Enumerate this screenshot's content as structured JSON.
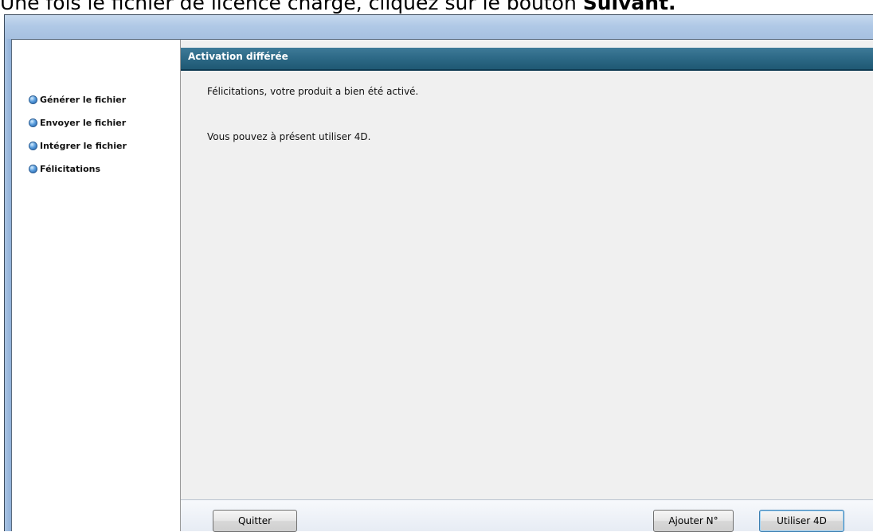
{
  "caption": {
    "prefix": "Une fois le fichier de licence chargé, cliquez sur le bouton ",
    "bold": "Suivant."
  },
  "wizard": {
    "header_title": "Activation différée",
    "steps": [
      {
        "label": "Générer le fichier"
      },
      {
        "label": "Envoyer le fichier"
      },
      {
        "label": "Intégrer le fichier"
      },
      {
        "label": "Félicitations"
      }
    ],
    "messages": {
      "line1": "Félicitations, votre produit a bien été activé.",
      "line2": "Vous pouvez à présent utiliser 4D."
    },
    "buttons": {
      "quit": "Quitter",
      "add_number": "Ajouter N°",
      "use_4d": "Utiliser 4D"
    }
  }
}
